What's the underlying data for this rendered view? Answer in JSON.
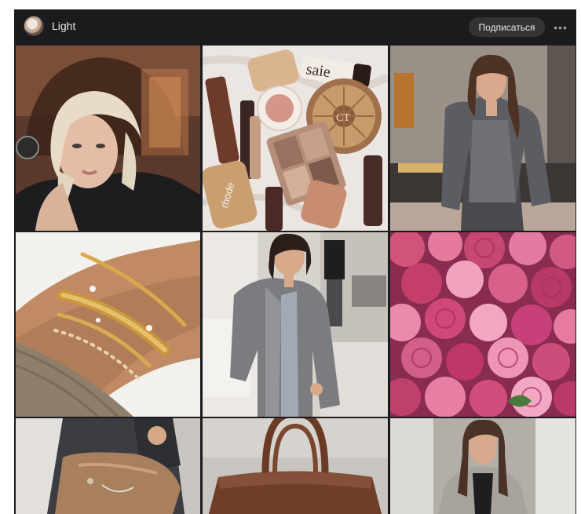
{
  "header": {
    "title": "Light",
    "subscribe_label": "Подписаться",
    "more_label": "•••"
  },
  "colors": {
    "background": "#1b1b1d",
    "subscribe_bg": "#333336",
    "text": "#e9e9ea"
  },
  "grid": {
    "tiles": [
      {
        "name": "blonde-woman-portrait-image"
      },
      {
        "name": "makeup-products-flatlay-image"
      },
      {
        "name": "woman-grey-dress-image"
      },
      {
        "name": "gold-bracelets-wrist-image"
      },
      {
        "name": "woman-grey-blazer-image"
      },
      {
        "name": "pink-roses-bouquet-image"
      },
      {
        "name": "woman-leather-bag-image"
      },
      {
        "name": "brown-handbag-image"
      },
      {
        "name": "woman-grey-coat-image"
      }
    ],
    "makeup_labels": {
      "product_a": "saie",
      "product_b": "rhode",
      "product_c": "CT"
    }
  }
}
